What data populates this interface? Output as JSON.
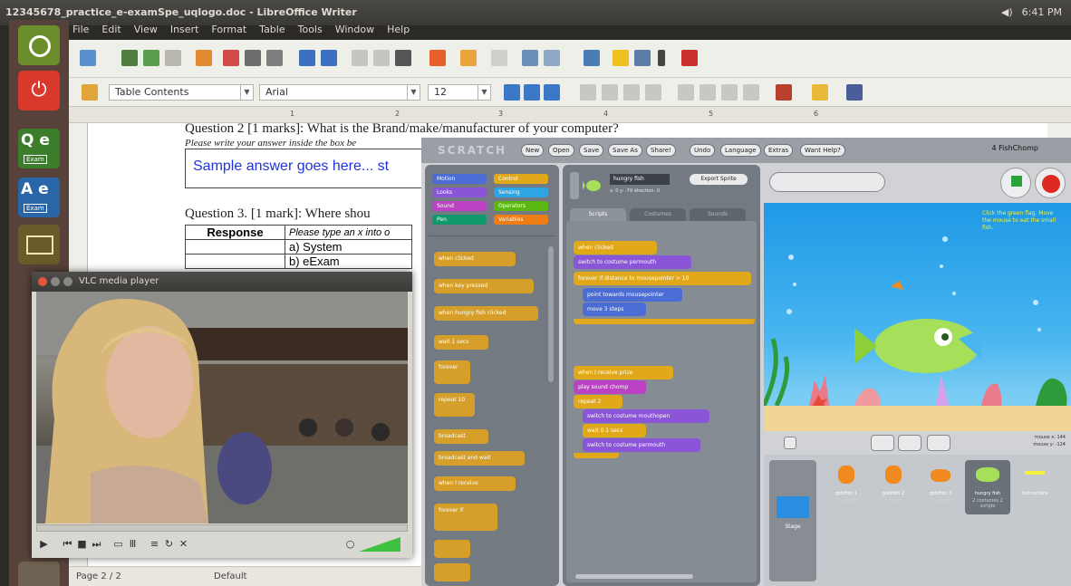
{
  "topbar": {
    "title": "12345678_practice_e-examSpe_uqlogo.doc - LibreOffice Writer",
    "time": "6:41 PM",
    "volume_icon": "speaker-icon"
  },
  "writer": {
    "menu": [
      "File",
      "Edit",
      "View",
      "Insert",
      "Format",
      "Table",
      "Tools",
      "Window",
      "Help"
    ],
    "style_value": "Table Contents",
    "font_value": "Arial",
    "size_value": "12",
    "ruler_marks": [
      "1",
      "2",
      "3",
      "4",
      "5",
      "6"
    ],
    "question2": "Question 2 [1 marks]: What is the Brand/make/manufacturer of your computer?",
    "question2_instr": "Please write your answer inside the box be",
    "answer": "Sample answer goes here... st",
    "question3": "Question 3. [1 mark]: Where shou",
    "table_header_left": "Response",
    "table_header_right": "Please type an x into o",
    "options": [
      "a) System",
      "b) eExam"
    ],
    "status_page": "Page 2 / 2",
    "status_style": "Default"
  },
  "vlc": {
    "title": "VLC media player"
  },
  "scratch": {
    "logo": "SCRATCH",
    "menu": [
      "New",
      "Open",
      "Save",
      "Save As",
      "Share!",
      "Undo",
      "Language",
      "Extras",
      "Want Help?"
    ],
    "project_name": "4 FishChomp",
    "sprite_name": "hungry fish",
    "export": "Export Sprite",
    "coords": "x: 0   y: -79   direction: 0",
    "tabs": [
      "Scripts",
      "Costumes",
      "Sounds"
    ],
    "categories": [
      "Motion",
      "Control",
      "Looks",
      "Sensing",
      "Sound",
      "Operators",
      "Pen",
      "Variables"
    ],
    "palette_blocks": [
      "when clicked",
      "when key pressed",
      "when hungry fish clicked",
      "wait 1 secs",
      "forever",
      "repeat 10",
      "broadcast",
      "broadcast and wait",
      "when I receive",
      "forever if"
    ],
    "script_blocks": [
      "when clicked",
      "switch to costume permouth",
      "forever if distance to mousepointer > 10",
      "point towards mousepointer",
      "move 3 steps",
      "when I receive prize",
      "play sound chomp",
      "repeat 2",
      "switch to costume mouthopen",
      "wait 0.1 secs",
      "switch to costume permouth"
    ],
    "stage_note": "Click the green flag. Move the mouse to eat the small fish.",
    "stage_label": "Stage",
    "mouse_x": "mouse x: 144",
    "mouse_y": "mouse y: -124",
    "sprites": [
      {
        "name": "goldfish 1",
        "sub": "1 script"
      },
      {
        "name": "goldfish 2",
        "sub": "1 script"
      },
      {
        "name": "goldfish 3",
        "sub": "1 script"
      },
      {
        "name": "hungry fish",
        "sub": "2 costumes 2 scripts"
      },
      {
        "name": "Instructions",
        "sub": ""
      }
    ]
  }
}
